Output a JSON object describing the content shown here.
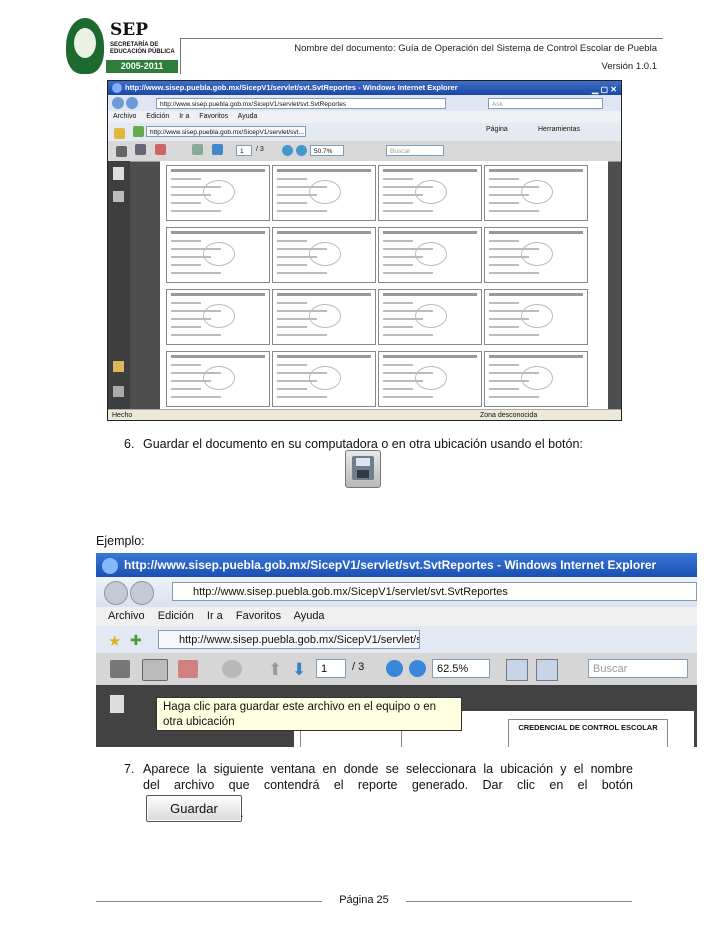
{
  "header": {
    "logo_text": "SEP",
    "logo_line1": "SECRETARÍA DE",
    "logo_line2": "EDUCACIÓN PÚBLICA",
    "logo_years": "2005-2011",
    "doc_title": "Nombre del documento: Guía de Operación del Sistema de Control Escolar de Puebla",
    "version": "Versión 1.0.1"
  },
  "screenshot1": {
    "window_title": "http://www.sisep.puebla.gob.mx/SicepV1/servlet/svt.SvtReportes - Windows Internet Explorer",
    "address": "http://www.sisep.puebla.gob.mx/SicepV1/servlet/svt.SvtReportes",
    "search_placeholder": "Ask",
    "menu": [
      "Archivo",
      "Edición",
      "Ir a",
      "Favoritos",
      "Ayuda"
    ],
    "tab_label": "http://www.sisep.puebla.gob.mx/SicepV1/servlet/svt...",
    "right_tools": [
      "Página",
      "Herramientas"
    ],
    "page_num": "1",
    "page_total": "/ 3",
    "zoom": "50.7%",
    "find": "Buscar",
    "status_left": "Hecho",
    "status_right": "Zona desconocida"
  },
  "step6": {
    "number": "6.",
    "text": "Guardar el documento en su computadora o en otra ubicación usando el botón:"
  },
  "ejemplo_label": "Ejemplo:",
  "screenshot2": {
    "window_title": "http://www.sisep.puebla.gob.mx/SicepV1/servlet/svt.SvtReportes - Windows Internet Explorer",
    "address": "http://www.sisep.puebla.gob.mx/SicepV1/servlet/svt.SvtReportes",
    "menu": [
      "Archivo",
      "Edición",
      "Ir a",
      "Favoritos",
      "Ayuda"
    ],
    "tab_label": "http://www.sisep.puebla.gob.mx/SicepV1/servlet/svt...",
    "page_num": "1",
    "page_total": "/ 3",
    "zoom": "62.5%",
    "find": "Buscar",
    "tooltip": "Haga clic para guardar este archivo en el equipo o en otra ubicación",
    "card_heading": "CREDENCIAL DE CONTROL ESCOLAR"
  },
  "step7": {
    "number": "7.",
    "line1": "Aparece la siguiente ventana en donde se seleccionara la ubicación y el nombre",
    "line2": "del archivo que contendrá el reporte generado. Dar clic en el botón",
    "button_label": "Guardar",
    "tail": "."
  },
  "footer": {
    "page": "Página 25"
  }
}
